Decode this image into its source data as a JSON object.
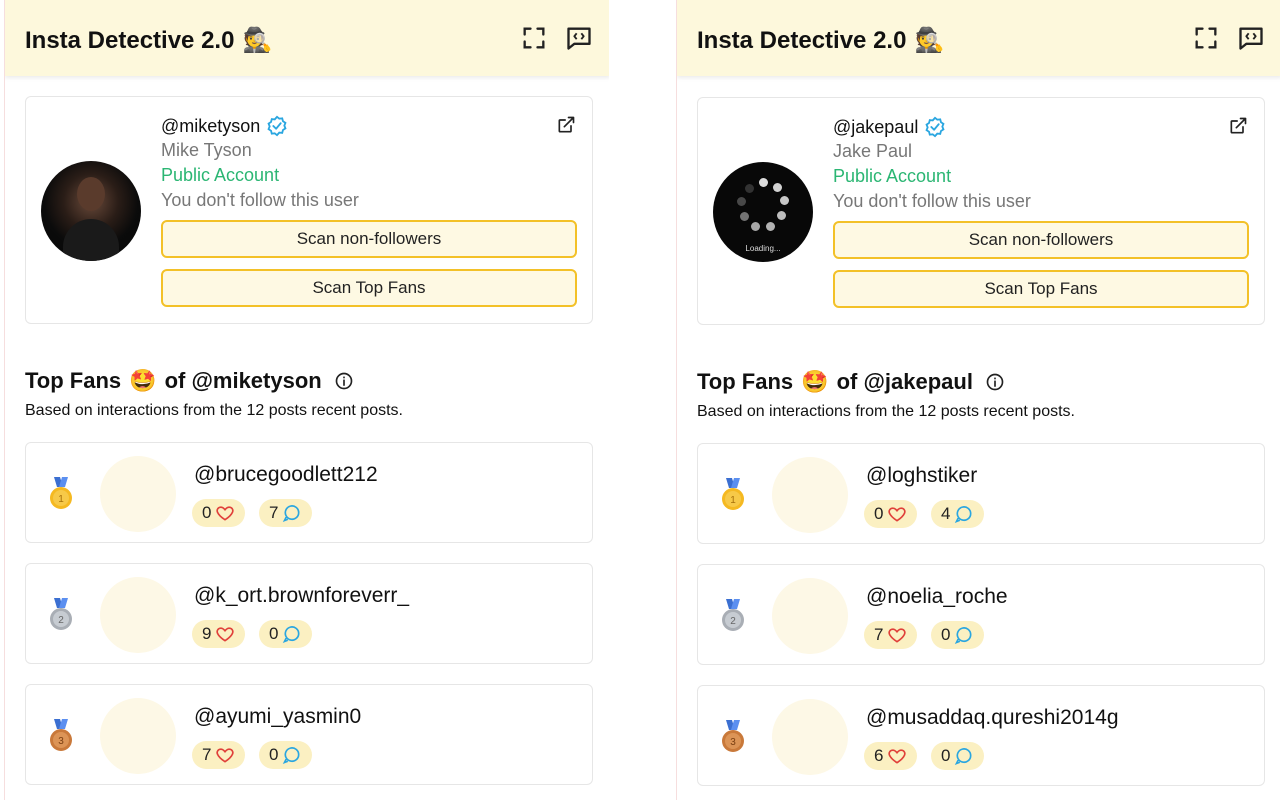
{
  "app": {
    "title": "Insta Detective 2.0",
    "title_emoji": "🕵️"
  },
  "colors": {
    "header_bg": "#fdf8dc",
    "accent": "#f3c128",
    "verified": "#2aa6e0",
    "public": "#2bb673",
    "heart": "#e0403a",
    "comment": "#2aa6e0"
  },
  "panels": [
    {
      "profile": {
        "handle": "@miketyson",
        "name": "Mike Tyson",
        "account_type": "Public Account",
        "follow_status": "You don't follow this user",
        "avatar_state": "photo"
      },
      "buttons": {
        "scan_non_followers": "Scan non-followers",
        "scan_top_fans": "Scan Top Fans"
      },
      "section": {
        "prefix": "Top Fans",
        "emoji": "🤩",
        "of_text": "of @miketyson",
        "subtitle": "Based on interactions from the 12 posts recent posts."
      },
      "fans": [
        {
          "rank": 1,
          "handle": "@brucegoodlett212",
          "likes": "0",
          "comments": "7"
        },
        {
          "rank": 2,
          "handle": "@k_ort.brownforeverr_",
          "likes": "9",
          "comments": "0"
        },
        {
          "rank": 3,
          "handle": "@ayumi_yasmin0",
          "likes": "7",
          "comments": "0"
        }
      ]
    },
    {
      "profile": {
        "handle": "@jakepaul",
        "name": "Jake Paul",
        "account_type": "Public Account",
        "follow_status": "You don't follow this user",
        "avatar_state": "loading",
        "loading_text": "Loading..."
      },
      "buttons": {
        "scan_non_followers": "Scan non-followers",
        "scan_top_fans": "Scan Top Fans"
      },
      "section": {
        "prefix": "Top Fans",
        "emoji": "🤩",
        "of_text": "of @jakepaul",
        "subtitle": "Based on interactions from the 12 posts recent posts."
      },
      "fans": [
        {
          "rank": 1,
          "handle": "@loghstiker",
          "likes": "0",
          "comments": "4"
        },
        {
          "rank": 2,
          "handle": "@noelia_roche",
          "likes": "7",
          "comments": "0"
        },
        {
          "rank": 3,
          "handle": "@musaddaq.qureshi2014g",
          "likes": "6",
          "comments": "0"
        }
      ]
    }
  ]
}
